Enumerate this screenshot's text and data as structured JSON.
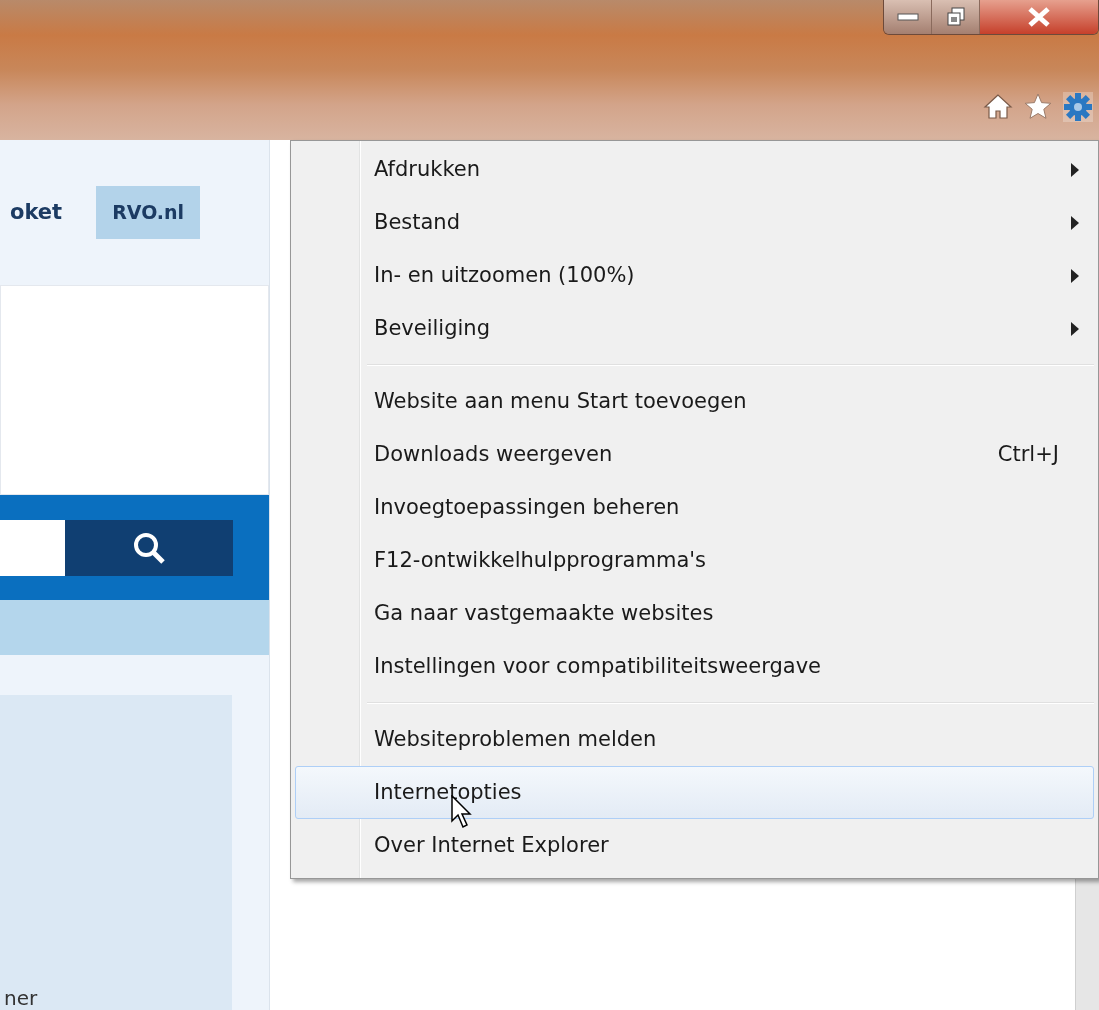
{
  "toolbar": {
    "buttons": [
      {
        "kind": "home"
      },
      {
        "kind": "favorites"
      },
      {
        "kind": "tools",
        "selected": true
      }
    ]
  },
  "page": {
    "header_text": "oket",
    "header_button": "RVO.nl",
    "footer_text": "ner"
  },
  "menu": {
    "groups": [
      [
        {
          "label": "Afdrukken",
          "submenu": true,
          "selected": false
        },
        {
          "label": "Bestand",
          "submenu": true,
          "selected": false
        },
        {
          "label": "In- en uitzoomen (100%)",
          "submenu": true,
          "selected": false
        },
        {
          "label": "Beveiliging",
          "submenu": true,
          "selected": false
        }
      ],
      [
        {
          "label": "Website aan menu Start toevoegen",
          "submenu": false,
          "selected": false
        },
        {
          "label": "Downloads weergeven",
          "shortcut": "Ctrl+J",
          "submenu": false,
          "selected": false
        },
        {
          "label": "Invoegtoepassingen beheren",
          "submenu": false,
          "selected": false
        },
        {
          "label": "F12-ontwikkelhulpprogramma's",
          "submenu": false,
          "selected": false
        },
        {
          "label": "Ga naar vastgemaakte websites",
          "submenu": false,
          "selected": false
        },
        {
          "label": "Instellingen voor compatibiliteitsweergave",
          "submenu": false,
          "selected": false
        }
      ],
      [
        {
          "label": "Websiteproblemen melden",
          "submenu": false,
          "selected": false
        },
        {
          "label": "Internetopties",
          "submenu": false,
          "selected": true
        },
        {
          "label": "Over Internet Explorer",
          "submenu": false,
          "selected": false
        }
      ]
    ]
  }
}
